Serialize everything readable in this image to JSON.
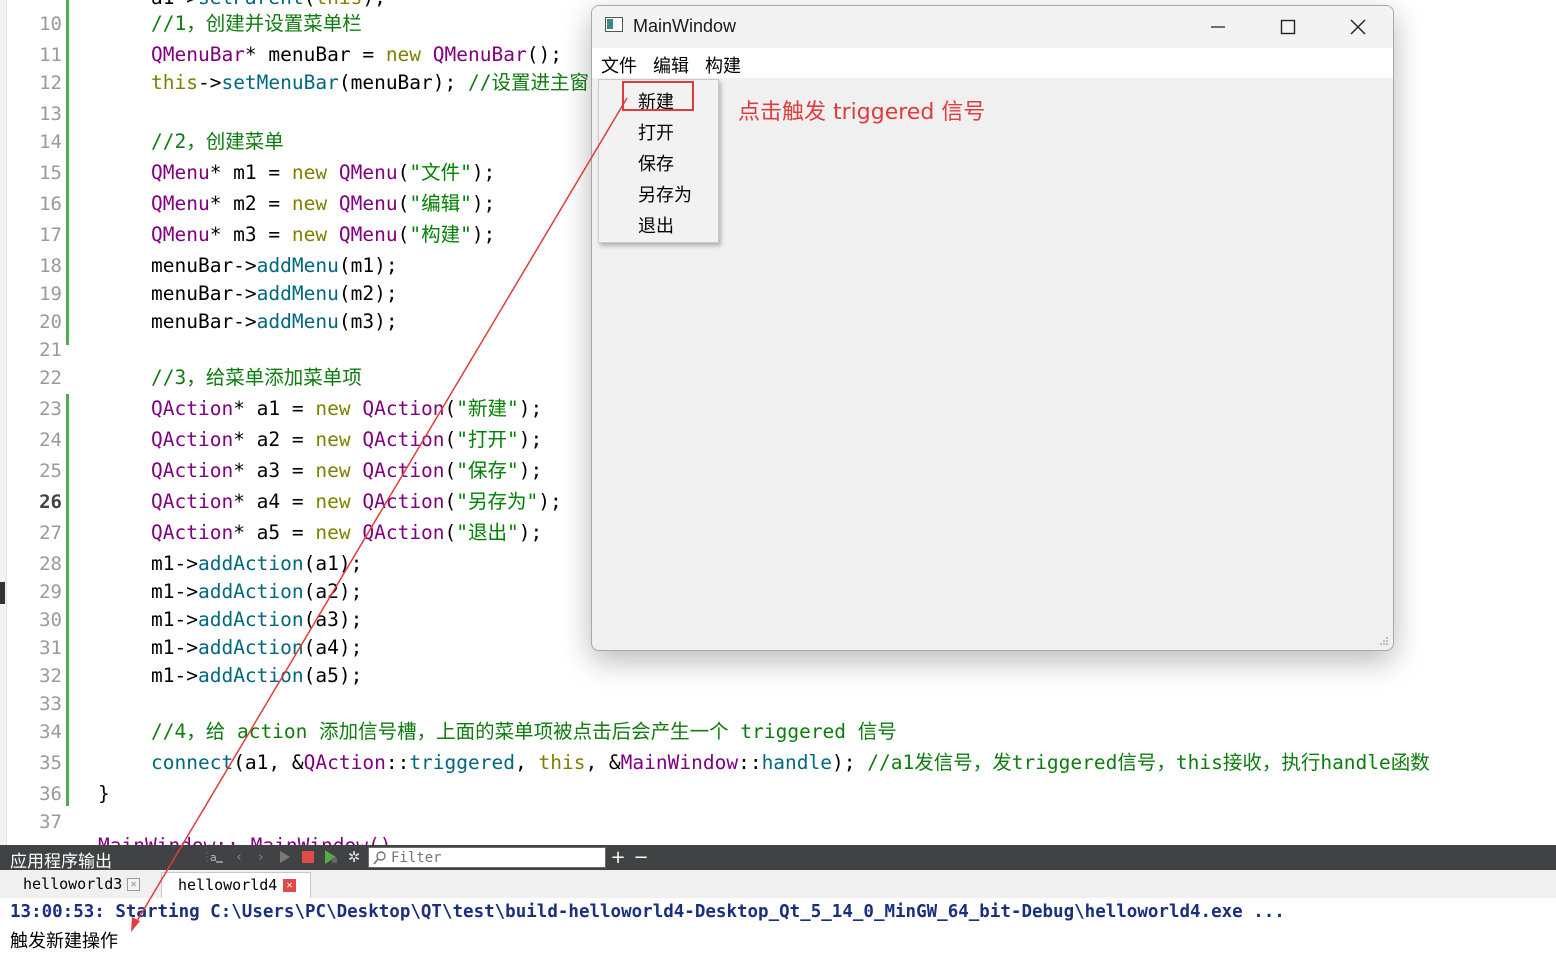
{
  "editor": {
    "lines": [
      {
        "n": "10",
        "segs": [
          [
            "//1，创建并设置菜单栏",
            "#0e7c0e"
          ]
        ]
      },
      {
        "n": "11",
        "segs": [
          [
            "QMenuBar",
            "#800080"
          ],
          [
            "* menuBar = ",
            "#000000"
          ],
          [
            "new",
            "#808000"
          ],
          [
            " ",
            "#000000"
          ],
          [
            "QMenuBar",
            "#800080"
          ],
          [
            "();",
            "#000000"
          ]
        ]
      },
      {
        "n": "12",
        "segs": [
          [
            "this",
            "#808000"
          ],
          [
            "->",
            "#000000"
          ],
          [
            "setMenuBar",
            "#00677c"
          ],
          [
            "(menuBar); ",
            "#000000"
          ],
          [
            "//设置进主窗口",
            "#0e7c0e"
          ]
        ]
      },
      {
        "n": "13",
        "segs": []
      },
      {
        "n": "14",
        "segs": [
          [
            "//2，创建菜单",
            "#0e7c0e"
          ]
        ]
      },
      {
        "n": "15",
        "segs": [
          [
            "QMenu",
            "#800080"
          ],
          [
            "* m1 = ",
            "#000000"
          ],
          [
            "new",
            "#808000"
          ],
          [
            " ",
            "#000000"
          ],
          [
            "QMenu",
            "#800080"
          ],
          [
            "(",
            "#000000"
          ],
          [
            "\"文件\"",
            "#008000"
          ],
          [
            ");",
            "#000000"
          ]
        ]
      },
      {
        "n": "16",
        "segs": [
          [
            "QMenu",
            "#800080"
          ],
          [
            "* m2 = ",
            "#000000"
          ],
          [
            "new",
            "#808000"
          ],
          [
            " ",
            "#000000"
          ],
          [
            "QMenu",
            "#800080"
          ],
          [
            "(",
            "#000000"
          ],
          [
            "\"编辑\"",
            "#008000"
          ],
          [
            ");",
            "#000000"
          ]
        ]
      },
      {
        "n": "17",
        "segs": [
          [
            "QMenu",
            "#800080"
          ],
          [
            "* m3 = ",
            "#000000"
          ],
          [
            "new",
            "#808000"
          ],
          [
            " ",
            "#000000"
          ],
          [
            "QMenu",
            "#800080"
          ],
          [
            "(",
            "#000000"
          ],
          [
            "\"构建\"",
            "#008000"
          ],
          [
            ");",
            "#000000"
          ]
        ]
      },
      {
        "n": "18",
        "segs": [
          [
            "menuBar->",
            "#000000"
          ],
          [
            "addMenu",
            "#00677c"
          ],
          [
            "(m1);",
            "#000000"
          ]
        ]
      },
      {
        "n": "19",
        "segs": [
          [
            "menuBar->",
            "#000000"
          ],
          [
            "addMenu",
            "#00677c"
          ],
          [
            "(m2);",
            "#000000"
          ]
        ]
      },
      {
        "n": "20",
        "segs": [
          [
            "menuBar->",
            "#000000"
          ],
          [
            "addMenu",
            "#00677c"
          ],
          [
            "(m3);",
            "#000000"
          ]
        ]
      },
      {
        "n": "21",
        "segs": []
      },
      {
        "n": "22",
        "segs": [
          [
            "//3，给菜单添加菜单项",
            "#0e7c0e"
          ]
        ]
      },
      {
        "n": "23",
        "segs": [
          [
            "QAction",
            "#800080"
          ],
          [
            "* a1 = ",
            "#000000"
          ],
          [
            "new",
            "#808000"
          ],
          [
            " ",
            "#000000"
          ],
          [
            "QAction",
            "#800080"
          ],
          [
            "(",
            "#000000"
          ],
          [
            "\"新建\"",
            "#008000"
          ],
          [
            ");",
            "#000000"
          ]
        ]
      },
      {
        "n": "24",
        "segs": [
          [
            "QAction",
            "#800080"
          ],
          [
            "* a2 = ",
            "#000000"
          ],
          [
            "new",
            "#808000"
          ],
          [
            " ",
            "#000000"
          ],
          [
            "QAction",
            "#800080"
          ],
          [
            "(",
            "#000000"
          ],
          [
            "\"打开\"",
            "#008000"
          ],
          [
            ");",
            "#000000"
          ]
        ]
      },
      {
        "n": "25",
        "segs": [
          [
            "QAction",
            "#800080"
          ],
          [
            "* a3 = ",
            "#000000"
          ],
          [
            "new",
            "#808000"
          ],
          [
            " ",
            "#000000"
          ],
          [
            "QAction",
            "#800080"
          ],
          [
            "(",
            "#000000"
          ],
          [
            "\"保存\"",
            "#008000"
          ],
          [
            ");",
            "#000000"
          ]
        ]
      },
      {
        "n": "26",
        "segs": [
          [
            "QAction",
            "#800080"
          ],
          [
            "* a4 = ",
            "#000000"
          ],
          [
            "new",
            "#808000"
          ],
          [
            " ",
            "#000000"
          ],
          [
            "QAction",
            "#800080"
          ],
          [
            "(",
            "#000000"
          ],
          [
            "\"另存为\"",
            "#008000"
          ],
          [
            ");",
            "#000000"
          ]
        ],
        "current": true
      },
      {
        "n": "27",
        "segs": [
          [
            "QAction",
            "#800080"
          ],
          [
            "* a5 = ",
            "#000000"
          ],
          [
            "new",
            "#808000"
          ],
          [
            " ",
            "#000000"
          ],
          [
            "QAction",
            "#800080"
          ],
          [
            "(",
            "#000000"
          ],
          [
            "\"退出\"",
            "#008000"
          ],
          [
            ");",
            "#000000"
          ]
        ]
      },
      {
        "n": "28",
        "segs": [
          [
            "m1->",
            "#000000"
          ],
          [
            "addAction",
            "#00677c"
          ],
          [
            "(a1);",
            "#000000"
          ]
        ]
      },
      {
        "n": "29",
        "segs": [
          [
            "m1->",
            "#000000"
          ],
          [
            "addAction",
            "#00677c"
          ],
          [
            "(a2);",
            "#000000"
          ]
        ]
      },
      {
        "n": "30",
        "segs": [
          [
            "m1->",
            "#000000"
          ],
          [
            "addAction",
            "#00677c"
          ],
          [
            "(a3);",
            "#000000"
          ]
        ]
      },
      {
        "n": "31",
        "segs": [
          [
            "m1->",
            "#000000"
          ],
          [
            "addAction",
            "#00677c"
          ],
          [
            "(a4);",
            "#000000"
          ]
        ]
      },
      {
        "n": "32",
        "segs": [
          [
            "m1->",
            "#000000"
          ],
          [
            "addAction",
            "#00677c"
          ],
          [
            "(a5);",
            "#000000"
          ]
        ]
      },
      {
        "n": "33",
        "segs": []
      },
      {
        "n": "34",
        "segs": [
          [
            "//4，给 action 添加信号槽，上面的菜单项被点击后会产生一个 triggered 信号",
            "#0e7c0e"
          ]
        ]
      },
      {
        "n": "35",
        "segs": [
          [
            "connect",
            "#00677c"
          ],
          [
            "(a1, &",
            "#000000"
          ],
          [
            "QAction",
            "#800080"
          ],
          [
            "::",
            "#000000"
          ],
          [
            "triggered",
            "#00677c"
          ],
          [
            ", ",
            "#000000"
          ],
          [
            "this",
            "#808000"
          ],
          [
            ", &",
            "#000000"
          ],
          [
            "MainWindow",
            "#800080"
          ],
          [
            "::",
            "#000000"
          ],
          [
            "handle",
            "#00677c"
          ],
          [
            "); ",
            "#000000"
          ],
          [
            "//a1发信号，发triggered信号，this接收，执行handle函数",
            "#0e7c0e"
          ]
        ]
      },
      {
        "n": "36",
        "segs": [
          [
            "}",
            "#000000"
          ]
        ]
      },
      {
        "n": "37",
        "segs": []
      }
    ]
  },
  "window": {
    "title": "MainWindow",
    "menus": [
      "文件",
      "编辑",
      "构建"
    ],
    "file_menu_items": [
      "新建",
      "打开",
      "保存",
      "另存为",
      "退出"
    ]
  },
  "annotation": {
    "text": "点击触发 triggered 信号",
    "color": "#e03c3c"
  },
  "output_panel": {
    "title": "应用程序输出",
    "filter_placeholder": "Filter",
    "tabs": [
      "helloworld3",
      "helloworld4"
    ],
    "active_tab": "helloworld4",
    "line1": "13:00:53: Starting C:\\Users\\PC\\Desktop\\QT\\test\\build-helloworld4-Desktop_Qt_5_14_0_MinGW_64_bit-Debug\\helloworld4.exe ...",
    "line2": "触发新建操作"
  }
}
